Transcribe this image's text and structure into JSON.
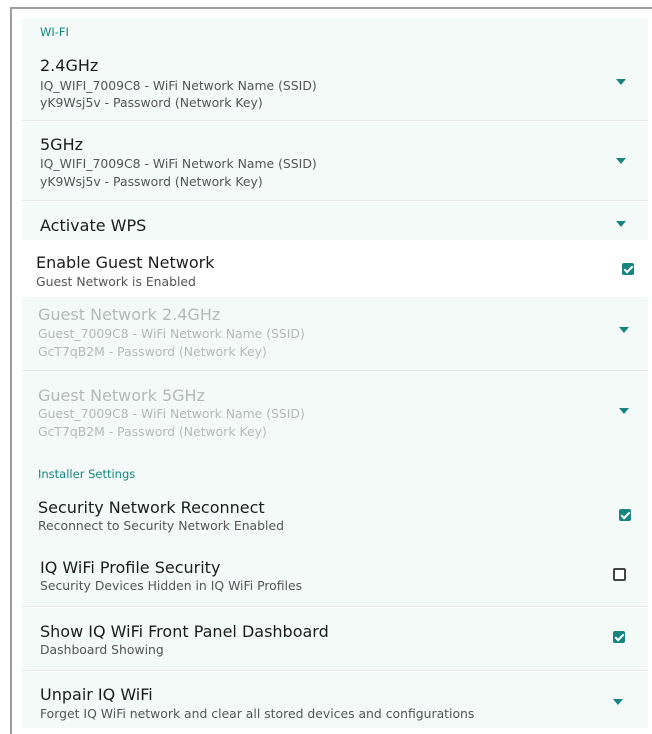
{
  "wifi": {
    "section_label": "WI-FI",
    "band_24": {
      "title": "2.4GHz",
      "ssid": "IQ_WIFI_7009C8 - WiFi Network Name (SSID)",
      "key": "yK9Wsj5v - Password (Network Key)"
    },
    "band_5": {
      "title": "5GHz",
      "ssid": "IQ_WIFI_7009C8 - WiFi Network Name (SSID)",
      "key": "yK9Wsj5v - Password (Network Key)"
    },
    "wps": {
      "title": "Activate WPS"
    },
    "guest_enable": {
      "title": "Enable Guest Network",
      "status": "Guest Network is Enabled",
      "checked": true
    },
    "guest_24": {
      "title": "Guest Network 2.4GHz",
      "ssid": "Guest_7009C8 - WiFi Network Name (SSID)",
      "key": "GcT7qB2M - Password (Network Key)"
    },
    "guest_5": {
      "title": "Guest Network 5GHz",
      "ssid": "Guest_7009C8 - WiFi Network Name (SSID)",
      "key": "GcT7qB2M - Password (Network Key)"
    }
  },
  "installer": {
    "section_label": "Installer Settings",
    "reconnect": {
      "title": "Security Network Reconnect",
      "status": "Reconnect to Security Network Enabled",
      "checked": true
    },
    "profile_security": {
      "title": "IQ WiFi Profile Security",
      "status": "Security Devices Hidden in IQ WiFi Profiles",
      "checked": false
    },
    "dashboard": {
      "title": "Show IQ WiFi Front Panel Dashboard",
      "status": "Dashboard Showing",
      "checked": true
    },
    "unpair": {
      "title": "Unpair IQ WiFi",
      "desc": "Forget IQ WiFi network and clear all stored devices and configurations"
    }
  },
  "colors": {
    "accent": "#16857f",
    "row_tint": "#f3faf7",
    "disabled_text": "#b5bab8"
  },
  "icons": {
    "expand": "dropdown-arrow-icon",
    "checked": "checkbox-checked-icon",
    "unchecked": "checkbox-empty-icon"
  }
}
